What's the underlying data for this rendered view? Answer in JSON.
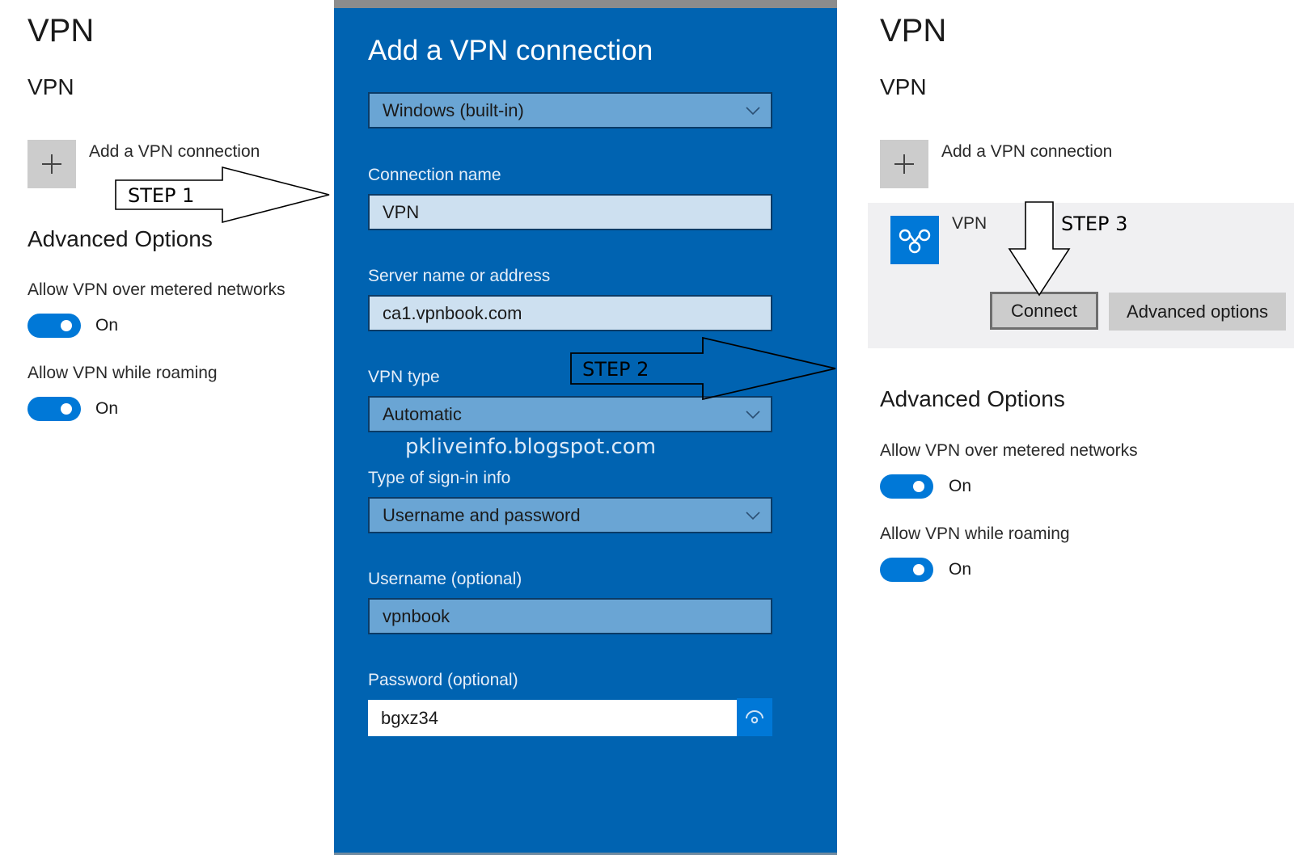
{
  "left": {
    "page_title": "VPN",
    "section_title": "VPN",
    "add_connection_label": "Add a VPN connection",
    "advanced_title": "Advanced Options",
    "options": [
      {
        "label": "Allow VPN over metered networks",
        "state": "On",
        "enabled": true
      },
      {
        "label": "Allow VPN while roaming",
        "state": "On",
        "enabled": true
      }
    ]
  },
  "dialog": {
    "title": "Add a VPN connection",
    "provider": {
      "value": "Windows (built-in)"
    },
    "connection_name": {
      "label": "Connection name",
      "value": "VPN"
    },
    "server": {
      "label": "Server name or address",
      "value": "ca1.vpnbook.com"
    },
    "vpn_type": {
      "label": "VPN type",
      "value": "Automatic"
    },
    "signin_type": {
      "label": "Type of sign-in info",
      "value": "Username and password"
    },
    "username": {
      "label": "Username (optional)",
      "value": "vpnbook"
    },
    "password": {
      "label": "Password (optional)",
      "value": "bgxz34"
    },
    "watermark": "pkliveinfo.blogspot.com"
  },
  "right": {
    "page_title": "VPN",
    "section_title": "VPN",
    "add_connection_label": "Add a VPN connection",
    "connection": {
      "name": "VPN",
      "connect_label": "Connect",
      "advanced_label": "Advanced options"
    },
    "advanced_title": "Advanced Options",
    "options": [
      {
        "label": "Allow VPN over metered networks",
        "state": "On",
        "enabled": true
      },
      {
        "label": "Allow VPN while roaming",
        "state": "On",
        "enabled": true
      }
    ]
  },
  "annotations": {
    "step1": "STEP 1",
    "step2": "STEP 2",
    "step3": "STEP 3"
  },
  "colors": {
    "accent": "#0078d7",
    "dialog_bg": "#0063b1",
    "select_bg": "#6aa5d4",
    "input_bg": "#cde0f0"
  }
}
